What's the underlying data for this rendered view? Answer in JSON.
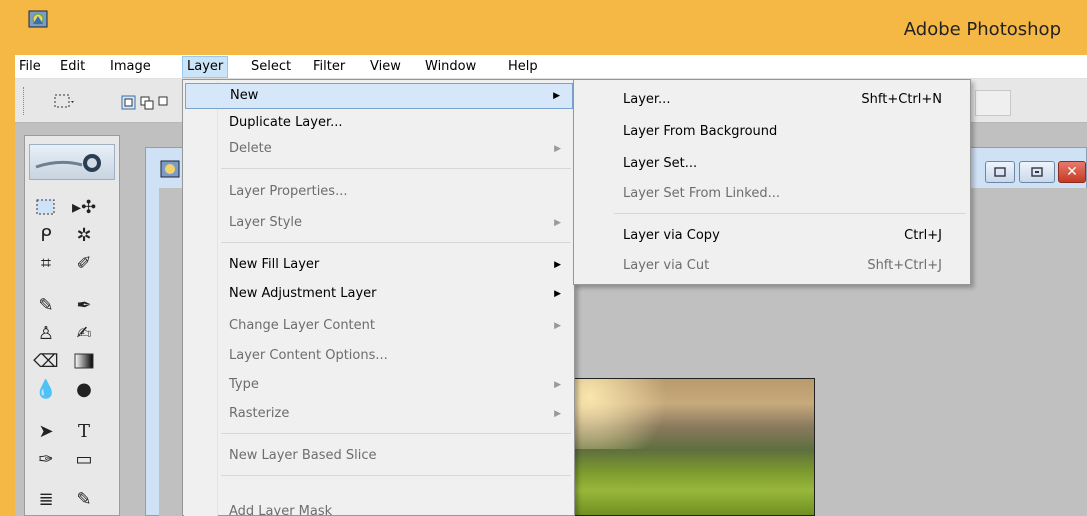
{
  "app": {
    "title": "Adobe Photoshop"
  },
  "menubar": [
    "File",
    "Edit",
    "Image",
    "Layer",
    "Select",
    "Filter",
    "View",
    "Window",
    "Help"
  ],
  "layer_menu": {
    "items": [
      {
        "label": "New",
        "submenu": true,
        "enabled": true,
        "highlighted": true
      },
      {
        "label": "Duplicate Layer...",
        "submenu": false,
        "enabled": true
      },
      {
        "label": "Delete",
        "submenu": true,
        "enabled": false
      },
      {
        "label": "Layer Properties...",
        "submenu": false,
        "enabled": false
      },
      {
        "label": "Layer Style",
        "submenu": true,
        "enabled": false
      },
      {
        "label": "New Fill Layer",
        "submenu": true,
        "enabled": true
      },
      {
        "label": "New Adjustment Layer",
        "submenu": true,
        "enabled": true
      },
      {
        "label": "Change Layer Content",
        "submenu": true,
        "enabled": false
      },
      {
        "label": "Layer Content Options...",
        "submenu": false,
        "enabled": false
      },
      {
        "label": "Type",
        "submenu": true,
        "enabled": false
      },
      {
        "label": "Rasterize",
        "submenu": true,
        "enabled": false
      },
      {
        "label": "New Layer Based Slice",
        "submenu": false,
        "enabled": false
      },
      {
        "label": "Add Layer Mask",
        "submenu": false,
        "enabled": false
      }
    ]
  },
  "new_submenu": {
    "items": [
      {
        "label": "Layer...",
        "shortcut": "Shft+Ctrl+N",
        "enabled": true
      },
      {
        "label": "Layer From Background",
        "shortcut": "",
        "enabled": true
      },
      {
        "label": "Layer Set...",
        "shortcut": "",
        "enabled": true
      },
      {
        "label": "Layer Set From Linked...",
        "shortcut": "",
        "enabled": false
      },
      {
        "label": "Layer via Copy",
        "shortcut": "Ctrl+J",
        "enabled": true
      },
      {
        "label": "Layer via Cut",
        "shortcut": "Shft+Ctrl+J",
        "enabled": false
      }
    ]
  },
  "colors": {
    "title_bar": "#f6b844",
    "menu_highlight": "#d5e7f8",
    "menu_bg": "#f0f0f0",
    "workspace": "#c0c0c0"
  }
}
